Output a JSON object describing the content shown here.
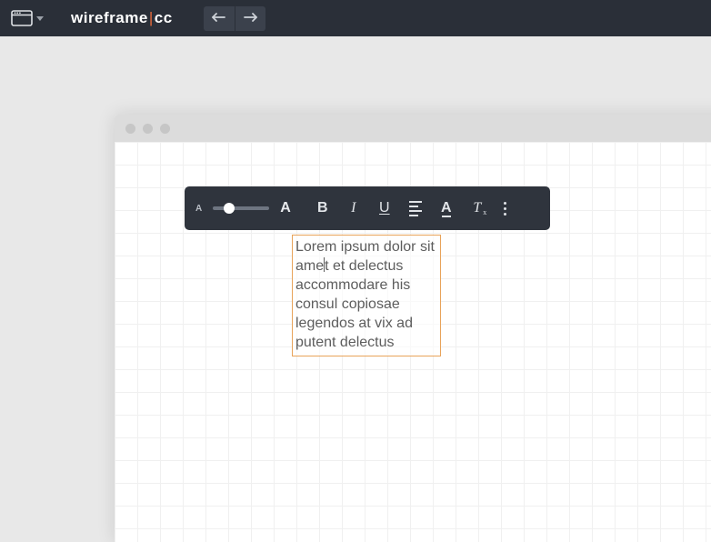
{
  "header": {
    "logo_part1": "wireframe",
    "logo_bar": "|",
    "logo_part2": "cc"
  },
  "toolbar": {
    "font_size_small_label": "A",
    "font_size_large_label": "A",
    "bold_label": "B",
    "italic_label": "I",
    "underline_label": "U",
    "color_label": "A",
    "clear_label": "T",
    "clear_x": "x"
  },
  "textblock": {
    "before_caret": "Lorem ipsum dolor sit ame",
    "after_caret": "t et delectus accommodare his consul copiosae legendos at vix ad putent delectus"
  },
  "colors": {
    "header_bg": "#2a2f38",
    "toolbar_bg": "#2f343d",
    "selection_border": "#e8a35a",
    "accent_orange": "#e86a3a"
  }
}
